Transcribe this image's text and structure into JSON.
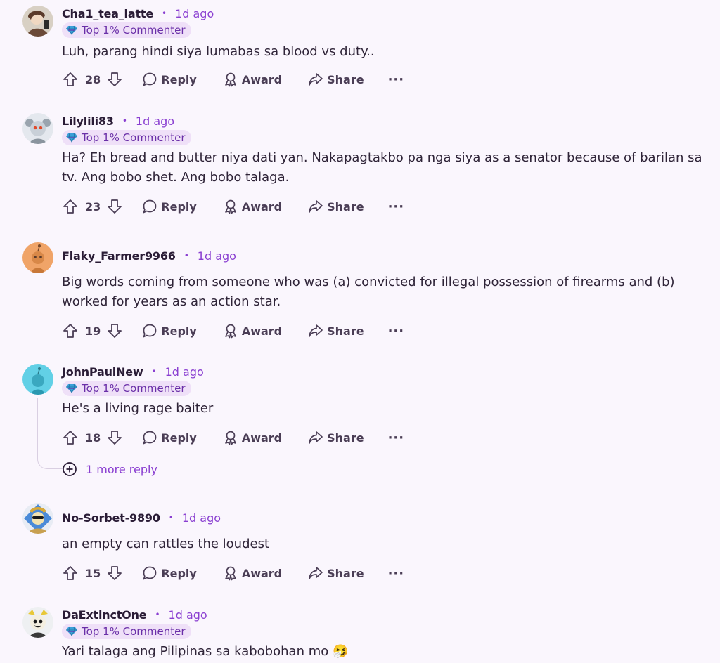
{
  "accent_color": "#8a3fd1",
  "badge_color": "#efe0f8",
  "comments": [
    {
      "author": "Cha1_tea_latte",
      "dot": "•",
      "time": "1d ago",
      "badge": "Top 1% Commenter",
      "body": "Luh, parang hindi siya lumabas sa blood vs duty..",
      "score": "28",
      "reply": "Reply",
      "award": "Award",
      "share": "Share",
      "more": "···"
    },
    {
      "author": "Lilylili83",
      "dot": "•",
      "time": "1d ago",
      "badge": "Top 1% Commenter",
      "body": "Ha? Eh bread and butter niya dati yan. Nakapagtakbo pa nga siya as a senator because of barilan sa tv. Ang bobo shet. Ang bobo talaga.",
      "score": "23",
      "reply": "Reply",
      "award": "Award",
      "share": "Share",
      "more": "···"
    },
    {
      "author": "Flaky_Farmer9966",
      "dot": "•",
      "time": "1d ago",
      "body": "Big words coming from someone who was (a) convicted for illegal possession of firearms and (b) worked for years as an action star.",
      "score": "19",
      "reply": "Reply",
      "award": "Award",
      "share": "Share",
      "more": "···"
    },
    {
      "author": "JohnPaulNew",
      "dot": "•",
      "time": "1d ago",
      "badge": "Top 1% Commenter",
      "body": "He's a living rage baiter",
      "score": "18",
      "reply": "Reply",
      "award": "Award",
      "share": "Share",
      "more": "···",
      "more_replies": "1 more reply"
    },
    {
      "author": "No-Sorbet-9890",
      "dot": "•",
      "time": "1d ago",
      "body": "an empty can rattles the loudest",
      "score": "15",
      "reply": "Reply",
      "award": "Award",
      "share": "Share",
      "more": "···"
    },
    {
      "author": "DaExtinctOne",
      "dot": "•",
      "time": "1d ago",
      "badge": "Top 1% Commenter",
      "body": "Yari talaga ang Pilipinas sa kabobohan mo 🤧"
    }
  ],
  "icons": {
    "upvote": "upvote-arrow-icon",
    "downvote": "downvote-arrow-icon",
    "reply": "speech-bubble-icon",
    "award": "award-ribbon-icon",
    "share": "share-arrow-icon",
    "more": "ellipsis-icon",
    "badge": "gem-icon",
    "expand": "plus-circle-icon"
  }
}
